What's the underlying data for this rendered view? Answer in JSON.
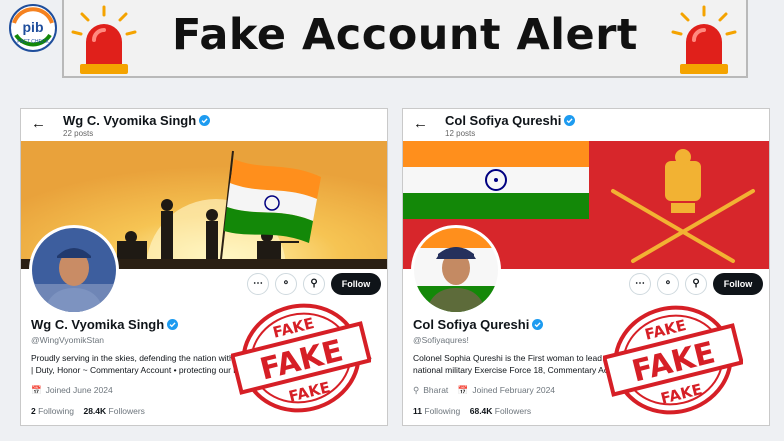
{
  "banner": {
    "title": "Fake Account Alert",
    "logo_text": "pib",
    "logo_subtext": "FACT CHECK"
  },
  "stamp_text": "FAKE",
  "profiles": [
    {
      "top_name": "Wg C. Vyomika Singh",
      "posts": "22 posts",
      "name": "Wg C. Vyomika Singh",
      "handle": "@WingVyomikStan",
      "bio": "Proudly serving in the skies, defending the nation with honor and courage. Indian Air Force | Duty, Honor ~ Commentary Account • protecting our motherland",
      "joined": "Joined June 2024",
      "following_count": "2",
      "following_label": "Following",
      "followers_count": "28.4K",
      "followers_label": "Followers",
      "follow_label": "Follow"
    },
    {
      "top_name": "Col Sofiya Qureshi",
      "posts": "12 posts",
      "name": "Col Sofiya Qureshi",
      "handle": "@Sofiyaqures!",
      "bio": "Colonel Sophia Qureshi is the First woman to lead an Indian Army contingent at a multi-national military Exercise Force 18, Commentary Account, Jai Hind",
      "location": "Bharat",
      "joined": "Joined February 2024",
      "following_count": "11",
      "following_label": "Following",
      "followers_count": "68.4K",
      "followers_label": "Followers",
      "follow_label": "Follow"
    }
  ],
  "icons": [
    "back-arrow-icon",
    "verified-badge-icon",
    "more-icon",
    "grok-icon",
    "search-icon",
    "calendar-icon",
    "location-icon",
    "siren-icon"
  ],
  "colors": {
    "accent": "#1d9bf0",
    "stamp": "#d61f26",
    "siren": "#e0201b",
    "follow_bg": "#0f1419"
  }
}
